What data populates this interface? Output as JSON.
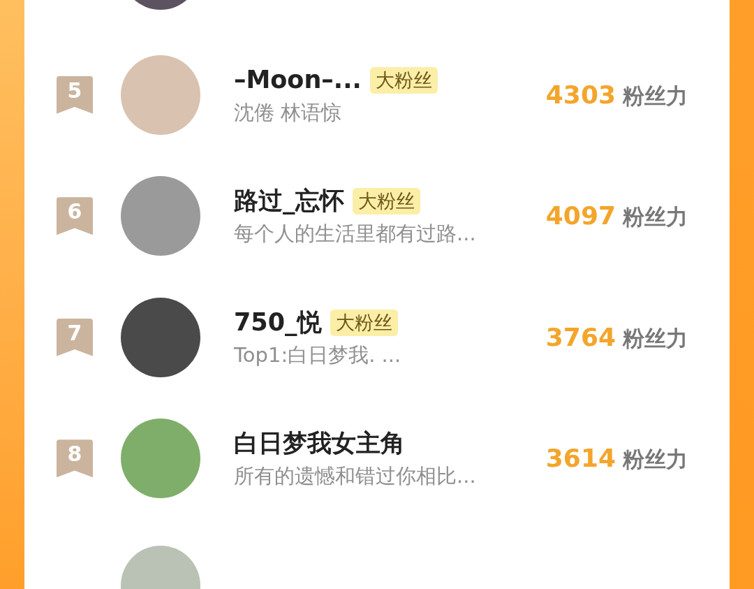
{
  "ranking": [
    {
      "rank": "5",
      "name": "–Moon–...",
      "badge": "大粉丝",
      "bio": "沈倦 林语惊",
      "score": "4303",
      "unit": "粉丝力"
    },
    {
      "rank": "6",
      "name": "路过_忘怀",
      "badge": "大粉丝",
      "bio": "每个人的生活里都有过路...",
      "score": "4097",
      "unit": "粉丝力"
    },
    {
      "rank": "7",
      "name": "750_悦",
      "badge": "大粉丝",
      "bio": "Top1:白日梦我. ...",
      "score": "3764",
      "unit": "粉丝力"
    },
    {
      "rank": "8",
      "name": "白日梦我女主角",
      "bio": "所有的遗憾和错过你相比...",
      "score": "3614",
      "unit": "粉丝力"
    }
  ]
}
